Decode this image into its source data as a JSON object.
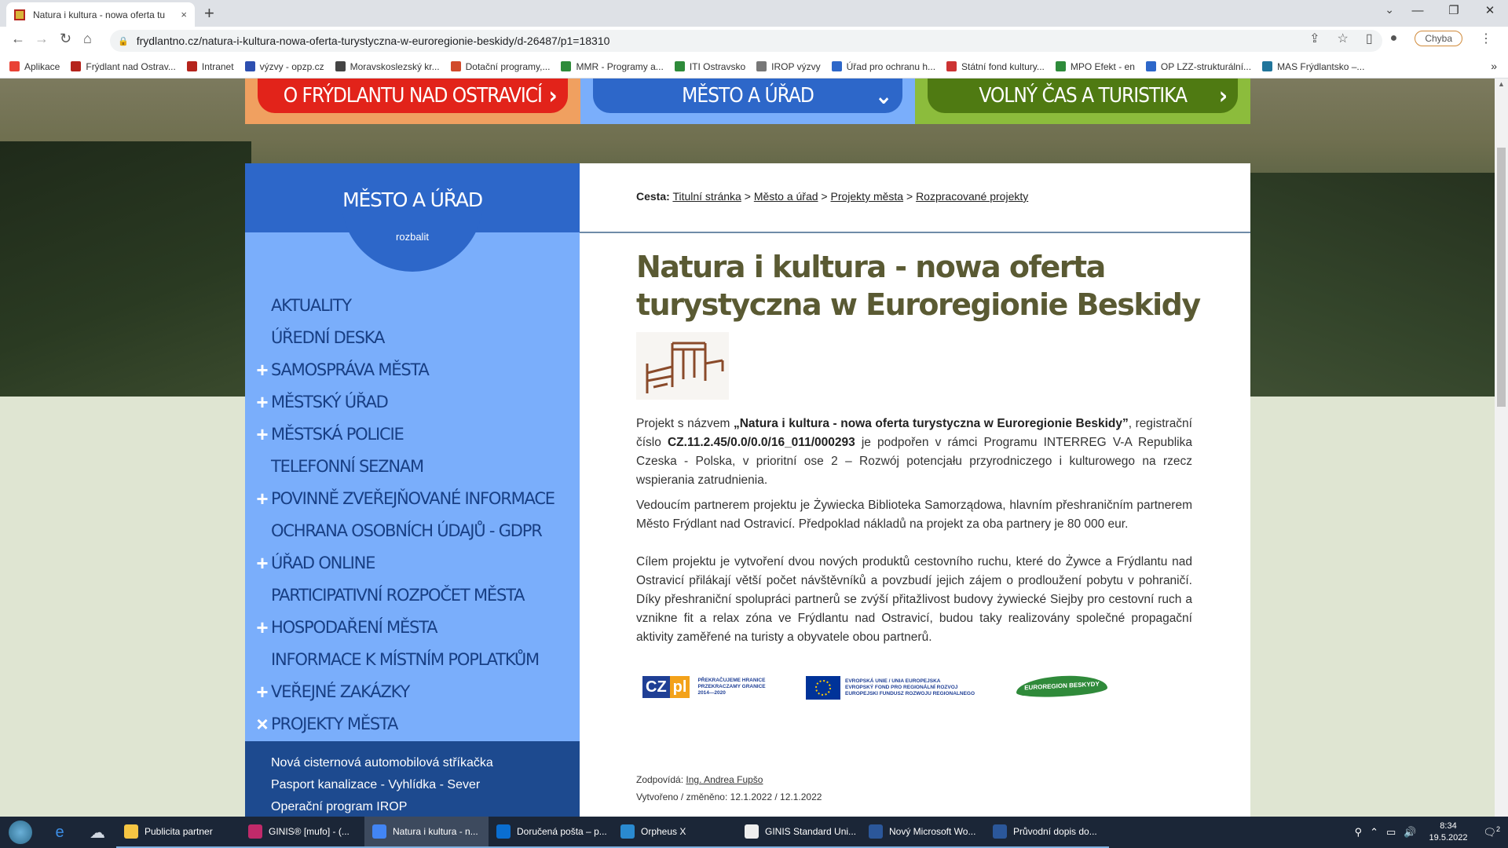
{
  "browser": {
    "tab_title": "Natura i kultura - nowa oferta tu",
    "tab_close": "×",
    "new_tab": "+",
    "url": "frydlantno.cz/natura-i-kultura-nowa-oferta-turystyczna-w-euroregionie-beskidy/d-26487/p1=18310",
    "profile_error": "Chyba",
    "window_controls": [
      "⌄",
      "—",
      "❐",
      "✕"
    ],
    "bookmarks": [
      {
        "label": "Aplikace",
        "color": "#e94235"
      },
      {
        "label": "Frýdlant nad Ostrav...",
        "color": "#b5241c"
      },
      {
        "label": "Intranet",
        "color": "#b5241c"
      },
      {
        "label": "výzvy - opzp.cz",
        "color": "#2d4fb0"
      },
      {
        "label": "Moravskoslezský kr...",
        "color": "#444"
      },
      {
        "label": "Dotační programy,...",
        "color": "#d14a2b"
      },
      {
        "label": "MMR - Programy a...",
        "color": "#2e8b3a"
      },
      {
        "label": "ITI Ostravsko",
        "color": "#2e8b3a"
      },
      {
        "label": "IROP výzvy",
        "color": "#777"
      },
      {
        "label": "Úřad pro ochranu h...",
        "color": "#2d67c9"
      },
      {
        "label": "Státní fond kultury...",
        "color": "#c33"
      },
      {
        "label": "MPO Efekt - en",
        "color": "#2e8b3a"
      },
      {
        "label": "OP LZZ-strukturální...",
        "color": "#2d67c9"
      },
      {
        "label": "MAS Frýdlantsko –...",
        "color": "#21759b"
      }
    ],
    "bookmarks_more": "»"
  },
  "topnav": [
    {
      "label": "O FRÝDLANTU NAD OSTRAVICÍ",
      "color": "#e2231a",
      "bg": "#f0a060",
      "arrow": "›"
    },
    {
      "label": "MĚSTO A ÚŘAD",
      "color": "#2d67c9",
      "bg": "#7aaefb",
      "arrow": "⌄"
    },
    {
      "label": "VOLNÝ ČAS A TURISTIKA",
      "color": "#4f7a12",
      "bg": "#8cbc3c",
      "arrow": "›"
    }
  ],
  "sidebar": {
    "title": "MĚSTO A ÚŘAD",
    "expand": "rozbalit",
    "items": [
      {
        "label": "AKTUALITY",
        "icon": ""
      },
      {
        "label": "ÚŘEDNÍ DESKA",
        "icon": ""
      },
      {
        "label": "SAMOSPRÁVA MĚSTA",
        "icon": "+"
      },
      {
        "label": "MĚSTSKÝ ÚŘAD",
        "icon": "+"
      },
      {
        "label": "MĚSTSKÁ POLICIE",
        "icon": "+"
      },
      {
        "label": "TELEFONNÍ SEZNAM",
        "icon": ""
      },
      {
        "label": "POVINNĚ ZVEŘEJŇOVANÉ INFORMACE",
        "icon": "+"
      },
      {
        "label": "OCHRANA OSOBNÍCH ÚDAJŮ - GDPR",
        "icon": ""
      },
      {
        "label": "ÚŘAD ONLINE",
        "icon": "+"
      },
      {
        "label": "PARTICIPATIVNÍ ROZPOČET MĚSTA",
        "icon": ""
      },
      {
        "label": "HOSPODAŘENÍ MĚSTA",
        "icon": "+"
      },
      {
        "label": "INFORMACE K MÍSTNÍM POPLATKŮM",
        "icon": ""
      },
      {
        "label": "VEŘEJNÉ ZAKÁZKY",
        "icon": "+"
      },
      {
        "label": "PROJEKTY MĚSTA",
        "icon": "×"
      }
    ],
    "subitems": [
      "Nová cisternová automobilová stříkačka",
      "Pasport kanalizace - Vyhlídka - Sever",
      "Operační program IROP"
    ]
  },
  "breadcrumb": {
    "prefix": "Cesta:",
    "links": [
      "Titulní stránka",
      "Město a úřad",
      "Projekty města",
      "Rozpracované projekty"
    ],
    "sep": " > "
  },
  "article": {
    "title": "Natura i kultura - nowa oferta turystyczna w Euroregionie Beskidy",
    "p1": {
      "t1": "Projekt s názvem ",
      "b1": "„Natura i kultura - nowa oferta turystyczna w Euroregionie Beskidy”",
      "t2": ", registrační číslo ",
      "b2": "CZ.11.2.45/0.0/0.0/16_011/000293",
      "t3": " je podpořen v rámci Programu INTERREG V-A Republika Czeska - Polska, v  prioritní ose 2 – Rozwój potencjału przyrodniczego i kulturowego na rzecz wspierania zatrudnienia."
    },
    "p2": "Vedoucím partnerem projektu je Żywiecka Biblioteka Samorządowa, hlavním přeshraničním partnerem Město Frýdlant nad Ostravicí. Předpoklad nákladů na projekt za oba partnery je 80 000 eur.",
    "p3": "Cílem projektu je vytvoření dvou nových produktů cestovního ruchu, které do Żywce a Frýdlantu nad Ostravicí přilákají větší počet návštěvníků a povzbudí jejich zájem o prodloužení pobytu v pohraničí. Díky přeshraniční spolupráci partnerů se zvýší přitažlivost budovy żywiecké Siejby pro cestovní ruch a vznikne fit a relax zóna ve Frýdlantu nad Ostravicí, budou taky realizovány společné propagační aktivity zaměřené na turisty a obyvatele obou partnerů."
  },
  "logos": {
    "czpl_mark": "CZ",
    "czpl_mark2": "pl",
    "czpl_text": [
      "PŘEKRAČUJEME HRANICE",
      "PRZEKRACZAMY GRANICE",
      "2014—2020"
    ],
    "eu_text": [
      "EVROPSKÁ UNIE / UNIA EUROPEJSKA",
      "EVROPSKÝ FOND PRO REGIONÁLNÍ ROZVOJ",
      "EUROPEJSKI FUNDUSZ ROZWOJU REGIONALNEGO"
    ],
    "euroregion": "EUROREGION BESKYDY"
  },
  "footer_meta": {
    "responsible_label": "Zodpovídá:",
    "responsible_name": "Ing. Andrea Fupšo",
    "created_label": "Vytvořeno / změněno:",
    "created_value": "12.1.2022 / 12.1.2022"
  },
  "taskbar": {
    "items": [
      {
        "label": "Publicita partner",
        "color": "#f5c543",
        "active": false
      },
      {
        "label": "GINIS® [mufo] - (...",
        "color": "#c02a6a",
        "active": false
      },
      {
        "label": "Natura i kultura - n...",
        "color": "#4285f4",
        "active": true
      },
      {
        "label": "Doručená pošta – p...",
        "color": "#0a6ed1",
        "active": false
      },
      {
        "label": "Orpheus X",
        "color": "#2a8ad0",
        "active": false
      },
      {
        "label": "GINIS Standard Uni...",
        "color": "#eeeeee",
        "active": false
      },
      {
        "label": "Nový Microsoft Wo...",
        "color": "#2b579a",
        "active": false
      },
      {
        "label": "Průvodní dopis do...",
        "color": "#2b579a",
        "active": false
      }
    ],
    "time": "8:34",
    "date": "19.5.2022",
    "notifications": "2"
  }
}
